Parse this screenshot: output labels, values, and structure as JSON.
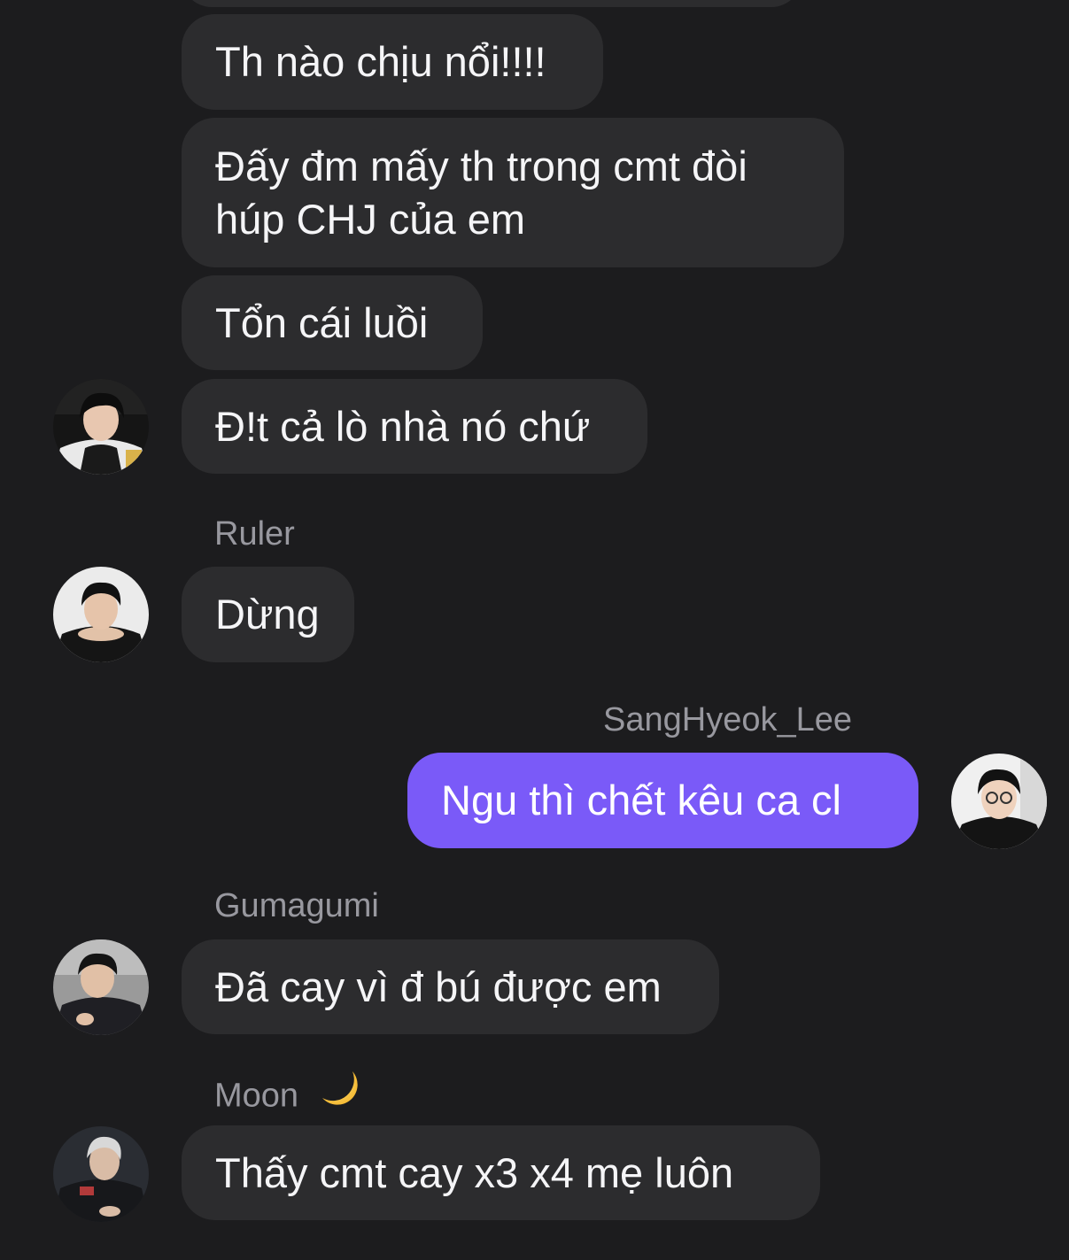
{
  "colors": {
    "background": "#1c1c1e",
    "bubble_incoming": "#2c2c2e",
    "bubble_outgoing": "#7a5af8",
    "sender_name": "#98989f",
    "text": "#f5f5f7"
  },
  "messages": [
    {
      "text": "Th nào chịu nổi!!!!"
    },
    {
      "text": "Đấy đm mấy th trong cmt đòi húp CHJ của em"
    },
    {
      "text": "Tổn cái luồi"
    },
    {
      "text": "Đ!t cả lò nhà nó chứ"
    },
    {
      "sender": "Ruler",
      "text": "Dừng"
    },
    {
      "sender": "SangHyeok_Lee",
      "text": "Ngu thì chết kêu ca cl"
    },
    {
      "sender": "Gumagumi",
      "text": "Đã cay vì đ bú được em"
    },
    {
      "sender": "Moon",
      "text": "Thấy cmt cay x3 x4 mẹ luôn"
    }
  ],
  "icons": {
    "moon_emoji": "crescent-moon-icon",
    "avatars": [
      "user-avatar",
      "ruler-avatar",
      "sanghyeok-lee-avatar",
      "gumagumi-avatar",
      "moon-avatar"
    ]
  }
}
